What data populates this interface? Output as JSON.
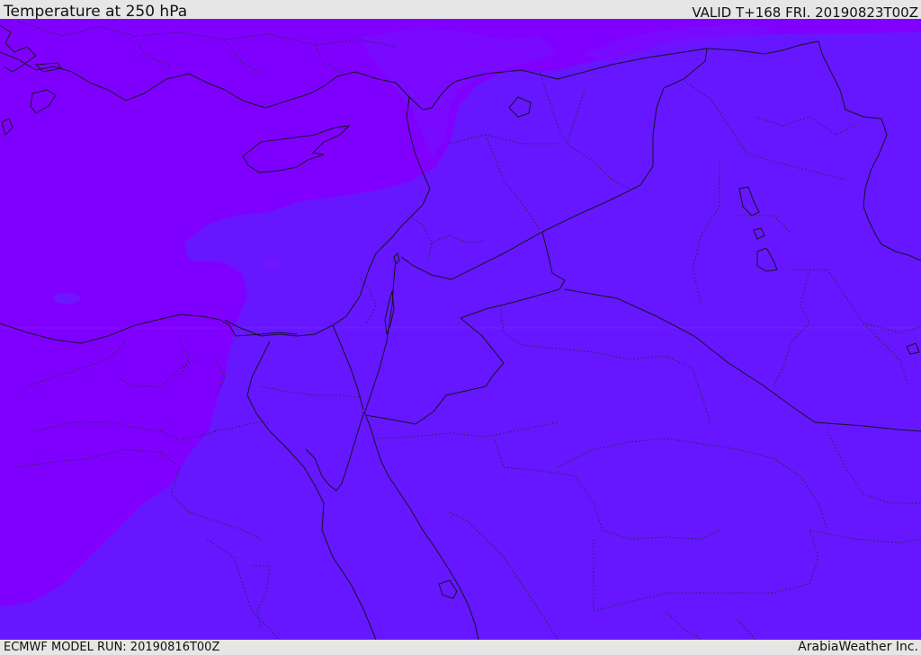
{
  "header": {
    "title": "Temperature at 250 hPa",
    "valid": "VALID T+168 FRI. 20190823T00Z"
  },
  "footer": {
    "model_run": "ECMWF MODEL RUN: 20190816T00Z",
    "credit": "ArabiaWeather Inc."
  },
  "map": {
    "region": "Eastern Mediterranean and Middle East",
    "colors": {
      "cold_shade": "#8000ff",
      "warm_shade": "#6617ff",
      "mid_shade": "#7211ff",
      "border": "#15151f"
    }
  }
}
